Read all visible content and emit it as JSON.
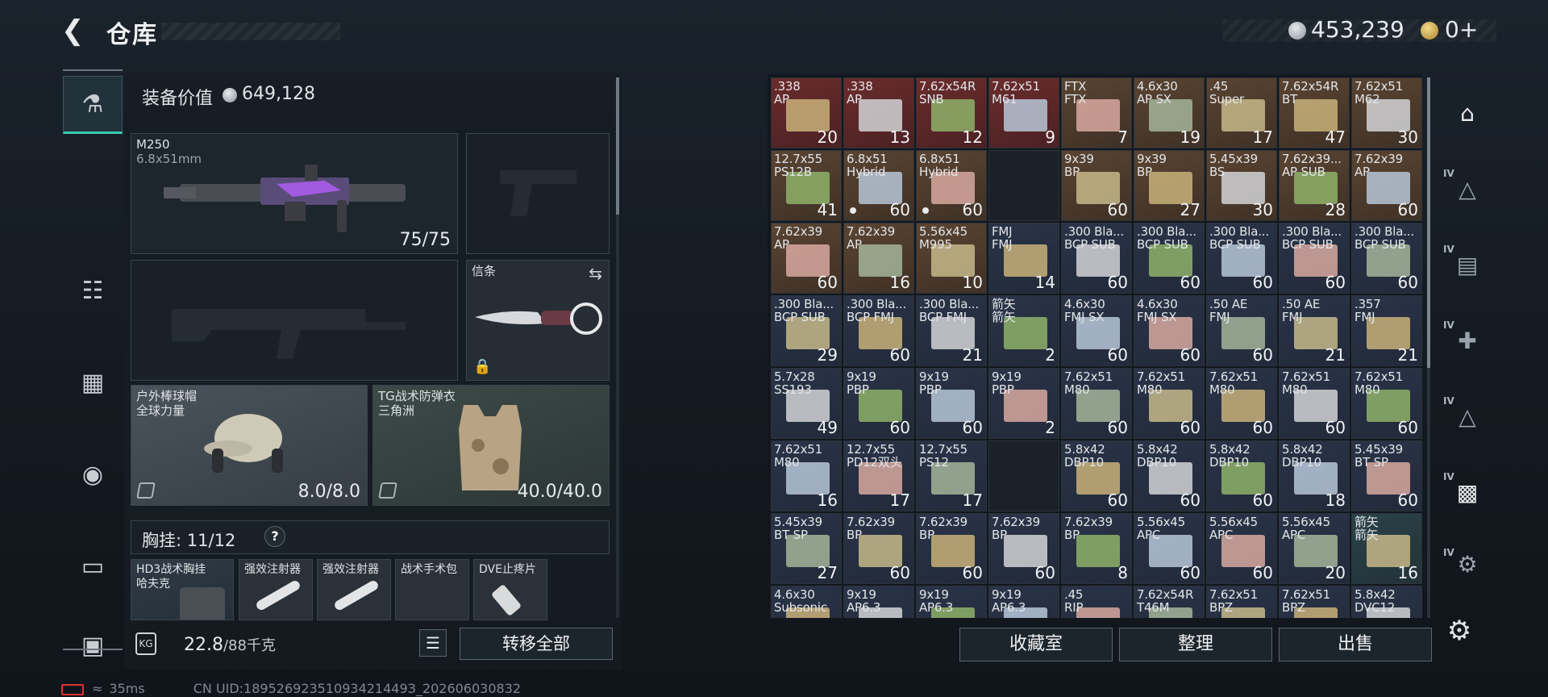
{
  "header": {
    "title": "仓库",
    "money": "453,239",
    "tickets": "0+"
  },
  "left_nav": {
    "items": [
      "weapon-icon",
      "armor-icon",
      "backpack-rig-icon",
      "bag-icon",
      "clipboard-icon",
      "toolbox-icon"
    ]
  },
  "equipment": {
    "value_label": "装备价值",
    "value": "649,128",
    "primary": {
      "name": "M250",
      "caliber": "6.8x51mm",
      "ammo": "75/75"
    },
    "melee": {
      "name": "信条"
    },
    "helmet": {
      "name": "户外棒球帽",
      "sub": "全球力量",
      "durability": "8.0/8.0"
    },
    "armor": {
      "name": "TG战术防弹衣",
      "sub": "三角洲",
      "durability": "40.0/40.0"
    },
    "chest": {
      "label": "胸挂:",
      "count": "11/12",
      "help": "?"
    },
    "chest_items": [
      {
        "name": "HD3战术胸挂",
        "sub": "哈夫克"
      },
      {
        "name": "强效注射器"
      },
      {
        "name": "强效注射器"
      },
      {
        "name": "战术手术包"
      },
      {
        "name": "DVE止疼片"
      }
    ]
  },
  "bottom_left": {
    "weight_current": "22.8",
    "weight_max": "/88千克",
    "weight_icon": "KG",
    "transfer_label": "转移全部"
  },
  "grid": {
    "cells": [
      {
        "name": ".338\nAP",
        "qty": "20",
        "bg": "red"
      },
      {
        "name": ".338\nAP",
        "qty": "13",
        "bg": "red"
      },
      {
        "name": "7.62x54R\nSNB",
        "qty": "12",
        "bg": "red"
      },
      {
        "name": "7.62x51\nM61",
        "qty": "9",
        "bg": "red"
      },
      {
        "name": "FTX\nFTX",
        "qty": "7",
        "bg": "brown"
      },
      {
        "name": "4.6x30\nAP SX",
        "qty": "19",
        "bg": "brown"
      },
      {
        "name": ".45\nSuper",
        "qty": "17",
        "bg": "brown"
      },
      {
        "name": "7.62x54R\nBT",
        "qty": "47",
        "bg": "brown"
      },
      {
        "name": "7.62x51\nM62",
        "qty": "30",
        "bg": "brown"
      },
      {
        "name": "12.7x55\nPS12B",
        "qty": "41",
        "bg": "brown"
      },
      {
        "name": "6.8x51\nHybrid",
        "qty": "60",
        "bg": "brown",
        "dot": true
      },
      {
        "name": "6.8x51\nHybrid",
        "qty": "60",
        "bg": "brown",
        "dot": true
      },
      {
        "name": "",
        "qty": "",
        "bg": "dark"
      },
      {
        "name": "9x39\nBP",
        "qty": "60",
        "bg": "brown"
      },
      {
        "name": "9x39\nBP",
        "qty": "27",
        "bg": "brown"
      },
      {
        "name": "5.45x39\nBS",
        "qty": "30",
        "bg": "brown"
      },
      {
        "name": "7.62x39...\nAP SUB",
        "qty": "28",
        "bg": "brown"
      },
      {
        "name": "7.62x39\nAP",
        "qty": "60",
        "bg": "brown"
      },
      {
        "name": "7.62x39\nAP",
        "qty": "60",
        "bg": "brown"
      },
      {
        "name": "7.62x39\nAP",
        "qty": "16",
        "bg": "brown"
      },
      {
        "name": "5.56x45\nM995",
        "qty": "10",
        "bg": "brown"
      },
      {
        "name": "FMJ\nFMJ",
        "qty": "14",
        "bg": "blue"
      },
      {
        "name": ".300 Bla...\nBCP SUB",
        "qty": "60",
        "bg": "blue"
      },
      {
        "name": ".300 Bla...\nBCP SUB",
        "qty": "60",
        "bg": "blue"
      },
      {
        "name": ".300 Bla...\nBCP SUB",
        "qty": "60",
        "bg": "blue"
      },
      {
        "name": ".300 Bla...\nBCP SUB",
        "qty": "60",
        "bg": "blue"
      },
      {
        "name": ".300 Bla...\nBCP SUB",
        "qty": "60",
        "bg": "blue"
      },
      {
        "name": ".300 Bla...\nBCP SUB",
        "qty": "29",
        "bg": "blue"
      },
      {
        "name": ".300 Bla...\nBCP FMJ",
        "qty": "60",
        "bg": "blue"
      },
      {
        "name": ".300 Bla...\nBCP FMJ",
        "qty": "21",
        "bg": "blue"
      },
      {
        "name": "箭矢\n箭矢",
        "qty": "2",
        "bg": "blue"
      },
      {
        "name": "4.6x30\nFMJ SX",
        "qty": "60",
        "bg": "blue"
      },
      {
        "name": "4.6x30\nFMJ SX",
        "qty": "60",
        "bg": "blue"
      },
      {
        "name": ".50 AE\nFMJ",
        "qty": "60",
        "bg": "blue"
      },
      {
        "name": ".50 AE\nFMJ",
        "qty": "21",
        "bg": "blue"
      },
      {
        "name": ".357\nFMJ",
        "qty": "21",
        "bg": "blue"
      },
      {
        "name": "5.7x28\nSS193",
        "qty": "49",
        "bg": "blue"
      },
      {
        "name": "9x19\nPBP",
        "qty": "60",
        "bg": "blue"
      },
      {
        "name": "9x19\nPBP",
        "qty": "60",
        "bg": "blue"
      },
      {
        "name": "9x19\nPBP",
        "qty": "2",
        "bg": "blue"
      },
      {
        "name": "7.62x51\nM80",
        "qty": "60",
        "bg": "blue"
      },
      {
        "name": "7.62x51\nM80",
        "qty": "60",
        "bg": "blue"
      },
      {
        "name": "7.62x51\nM80",
        "qty": "60",
        "bg": "blue"
      },
      {
        "name": "7.62x51\nM80",
        "qty": "60",
        "bg": "blue"
      },
      {
        "name": "7.62x51\nM80",
        "qty": "60",
        "bg": "blue"
      },
      {
        "name": "7.62x51\nM80",
        "qty": "16",
        "bg": "blue"
      },
      {
        "name": "12.7x55\nPD12双头",
        "qty": "17",
        "bg": "blue"
      },
      {
        "name": "12.7x55\nPS12",
        "qty": "17",
        "bg": "blue"
      },
      {
        "name": "",
        "qty": "",
        "bg": "dark"
      },
      {
        "name": "5.8x42\nDBP10",
        "qty": "60",
        "bg": "blue"
      },
      {
        "name": "5.8x42\nDBP10",
        "qty": "60",
        "bg": "blue"
      },
      {
        "name": "5.8x42\nDBP10",
        "qty": "60",
        "bg": "blue"
      },
      {
        "name": "5.8x42\nDBP10",
        "qty": "18",
        "bg": "blue"
      },
      {
        "name": "5.45x39\nBT SP",
        "qty": "60",
        "bg": "blue"
      },
      {
        "name": "5.45x39\nBT SP",
        "qty": "27",
        "bg": "blue"
      },
      {
        "name": "7.62x39\nBP",
        "qty": "60",
        "bg": "blue"
      },
      {
        "name": "7.62x39\nBP",
        "qty": "60",
        "bg": "blue"
      },
      {
        "name": "7.62x39\nBP",
        "qty": "60",
        "bg": "blue"
      },
      {
        "name": "7.62x39\nBP",
        "qty": "8",
        "bg": "blue"
      },
      {
        "name": "5.56x45\nAPC",
        "qty": "60",
        "bg": "blue"
      },
      {
        "name": "5.56x45\nAPC",
        "qty": "60",
        "bg": "blue"
      },
      {
        "name": "5.56x45\nAPC",
        "qty": "20",
        "bg": "blue"
      },
      {
        "name": "箭矢\n箭矢",
        "qty": "16",
        "bg": "teal"
      },
      {
        "name": "4.6x30\nSubsonic",
        "qty": "",
        "bg": "blue"
      },
      {
        "name": "9x19\nAP6.3",
        "qty": "",
        "bg": "blue"
      },
      {
        "name": "9x19\nAP6.3",
        "qty": "",
        "bg": "blue"
      },
      {
        "name": "9x19\nAP6.3",
        "qty": "",
        "bg": "blue"
      },
      {
        "name": ".45\nRIP",
        "qty": "",
        "bg": "blue"
      },
      {
        "name": "7.62x54R\nT46M",
        "qty": "",
        "bg": "blue"
      },
      {
        "name": "7.62x51\nBPZ",
        "qty": "",
        "bg": "blue"
      },
      {
        "name": "7.62x51\nBPZ",
        "qty": "",
        "bg": "blue"
      },
      {
        "name": "5.8x42\nDVC12",
        "qty": "",
        "bg": "blue"
      }
    ]
  },
  "right_nav": {
    "items": [
      {
        "icon": "vault-icon",
        "level": ""
      },
      {
        "icon": "warning-storage-icon",
        "level": "IV"
      },
      {
        "icon": "weapon-bench-icon",
        "level": "IV"
      },
      {
        "icon": "medical-station-icon",
        "level": "IV"
      },
      {
        "icon": "armor-bench-icon",
        "level": "IV"
      },
      {
        "icon": "storage-icon",
        "level": "IV"
      },
      {
        "icon": "tool-bench-icon",
        "level": "IV"
      }
    ]
  },
  "bottom_right": {
    "collection_label": "收藏室",
    "organize_label": "整理",
    "sell_label": "出售"
  },
  "status": {
    "ping": "35ms",
    "uid": "CN UID:18952692351093421449З_202606030832"
  }
}
